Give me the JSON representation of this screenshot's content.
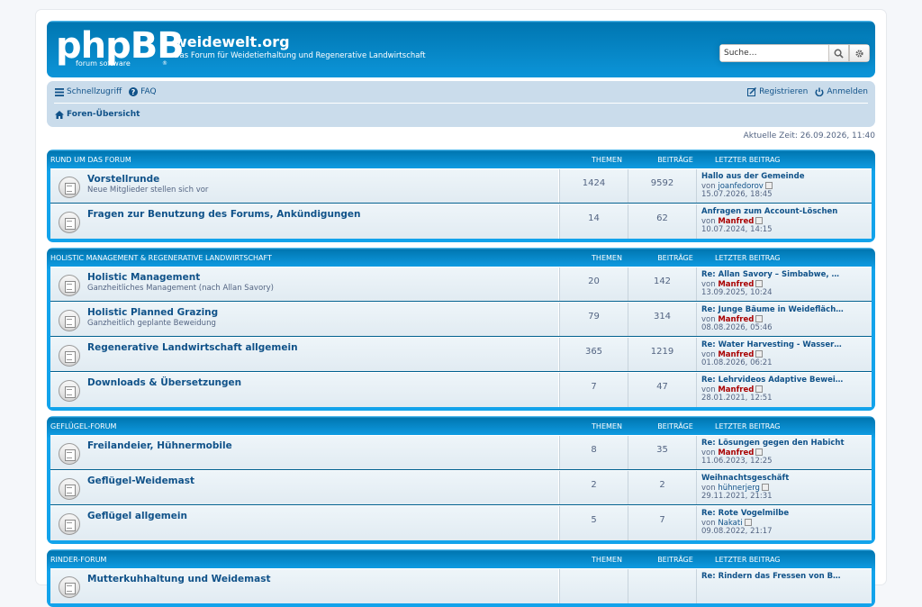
{
  "header": {
    "logo_main": "phpBB",
    "logo_sub": "forum   software",
    "logo_reg": "®",
    "site_title": "weidewelt.org",
    "site_desc": "Das Forum für Weidetierhaltung und Regenerative Landwirtschaft",
    "search_placeholder": "Suche…"
  },
  "nav": {
    "quick": "Schnellzugriff",
    "faq": "FAQ",
    "register": "Registrieren",
    "login": "Anmelden",
    "breadcrumb": "Foren-Übersicht"
  },
  "current_time": "Aktuelle Zeit: 26.09.2026, 11:40",
  "columns": {
    "topics": "Themen",
    "posts": "Beiträge",
    "last": "Letzter Beitrag"
  },
  "by": "von",
  "categories": [
    {
      "name": "Rund um das Forum",
      "forums": [
        {
          "title": "Vorstellrunde",
          "desc": "Neue Mitglieder stellen sich vor",
          "topics": "1424",
          "posts": "9592",
          "last_title": "Hallo aus der Gemeinde",
          "last_author": "joanfedorov",
          "author_red": false,
          "last_date": "15.07.2026, 18:45"
        },
        {
          "title": "Fragen zur Benutzung des Forums, Ankündigungen",
          "desc": "",
          "topics": "14",
          "posts": "62",
          "last_title": "Anfragen zum Account-Löschen",
          "last_author": "Manfred",
          "author_red": true,
          "last_date": "10.07.2024, 14:15"
        }
      ]
    },
    {
      "name": "Holistic Management & Regenerative Landwirtschaft",
      "forums": [
        {
          "title": "Holistic Management",
          "desc": "Ganzheitliches Management (nach Allan Savory)",
          "topics": "20",
          "posts": "142",
          "last_title": "Re: Allan Savory – Simbabwe, …",
          "last_author": "Manfred",
          "author_red": true,
          "last_date": "13.09.2025, 10:24"
        },
        {
          "title": "Holistic Planned Grazing",
          "desc": "Ganzheitlich geplante Beweidung",
          "topics": "79",
          "posts": "314",
          "last_title": "Re: Junge Bäume in Weidefläch…",
          "last_author": "Manfred",
          "author_red": true,
          "last_date": "08.08.2026, 05:46"
        },
        {
          "title": "Regenerative Landwirtschaft allgemein",
          "desc": "",
          "topics": "365",
          "posts": "1219",
          "last_title": "Re: Water Harvesting - Wasser…",
          "last_author": "Manfred",
          "author_red": true,
          "last_date": "01.08.2026, 06:21"
        },
        {
          "title": "Downloads & Übersetzungen",
          "desc": "",
          "topics": "7",
          "posts": "47",
          "last_title": "Re: Lehrvideos Adaptive Bewei…",
          "last_author": "Manfred",
          "author_red": true,
          "last_date": "28.01.2021, 12:51"
        }
      ]
    },
    {
      "name": "Geflügel-Forum",
      "forums": [
        {
          "title": "Freilandeier, Hühnermobile",
          "desc": "",
          "topics": "8",
          "posts": "35",
          "last_title": "Re: Lösungen gegen den Habicht",
          "last_author": "Manfred",
          "author_red": true,
          "last_date": "11.06.2023, 12:25"
        },
        {
          "title": "Geflügel-Weidemast",
          "desc": "",
          "topics": "2",
          "posts": "2",
          "last_title": "Weihnachtsgeschäft",
          "last_author": "hühnerjerg",
          "author_red": false,
          "last_date": "29.11.2021, 21:31"
        },
        {
          "title": "Geflügel allgemein",
          "desc": "",
          "topics": "5",
          "posts": "7",
          "last_title": "Re: Rote Vogelmilbe",
          "last_author": "Nakati",
          "author_red": false,
          "last_date": "09.08.2022, 21:17"
        }
      ]
    },
    {
      "name": "Rinder-Forum",
      "forums": [
        {
          "title": "Mutterkuhhaltung und Weidemast",
          "desc": "",
          "topics": "",
          "posts": "",
          "last_title": "Re: Rindern das Fressen von B…",
          "last_author": "",
          "author_red": false,
          "last_date": ""
        }
      ]
    }
  ]
}
